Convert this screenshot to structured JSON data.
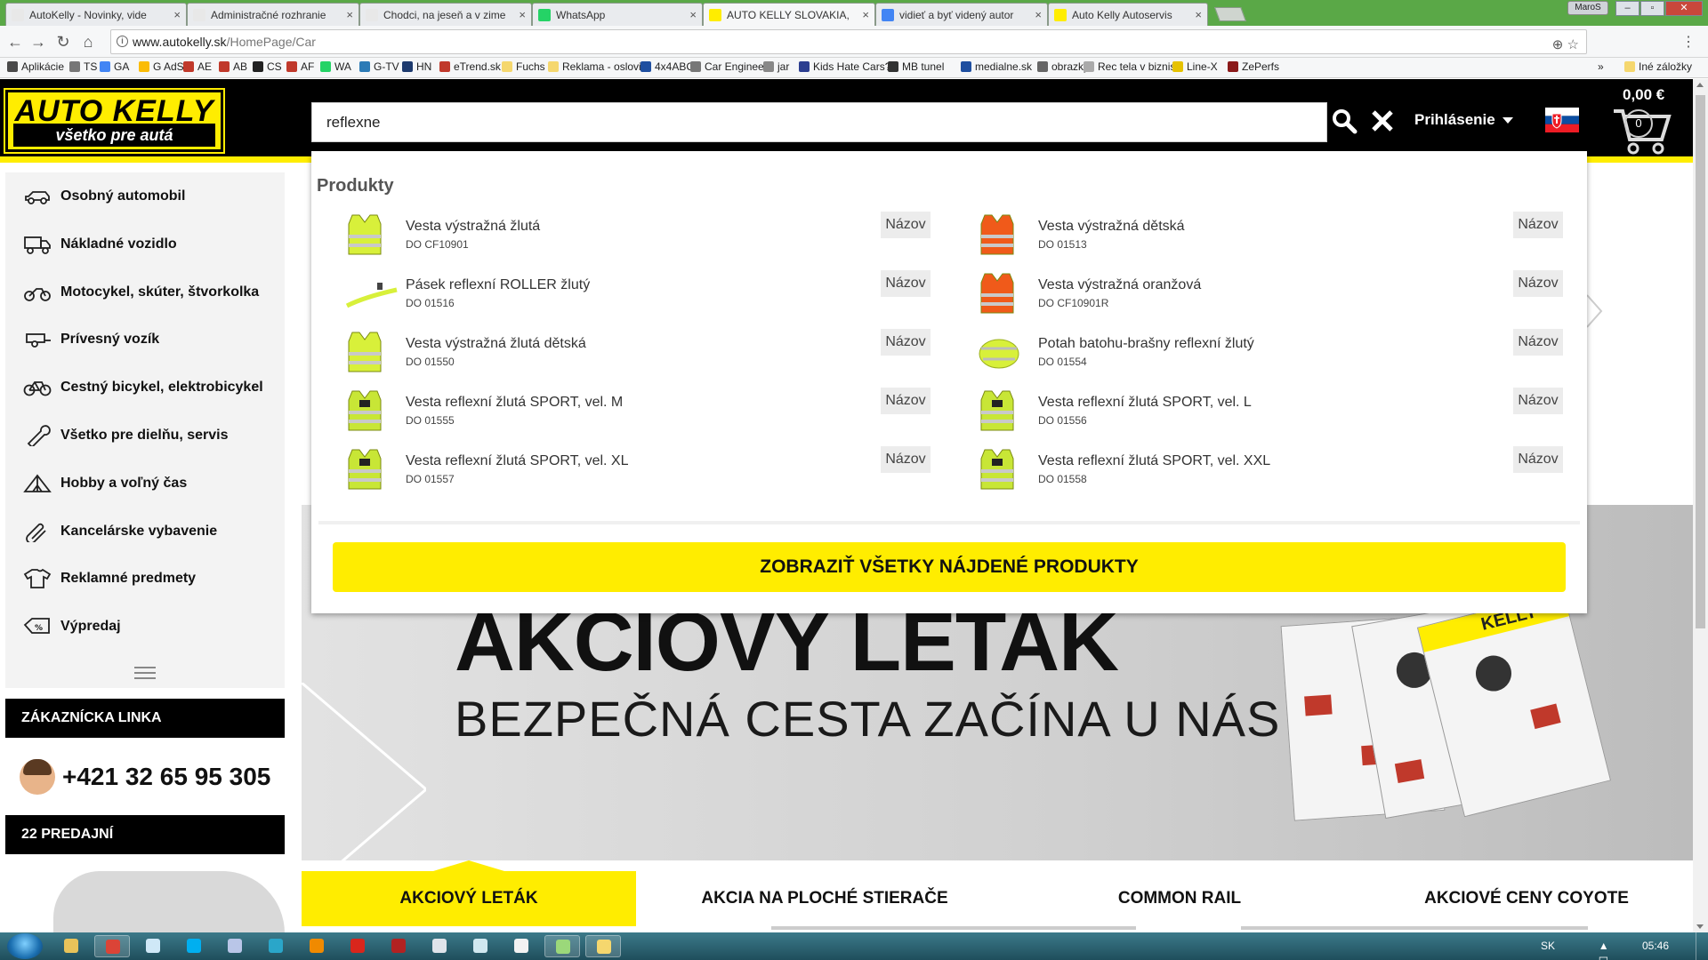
{
  "browser": {
    "tabs": [
      {
        "title": "AutoKelly - Novinky, vide",
        "fav_color": "#e8e8e8",
        "active": false
      },
      {
        "title": "Administračné rozhranie",
        "fav_color": "#e8e8e8",
        "active": false
      },
      {
        "title": "Chodci, na jeseň a v zime",
        "fav_color": "#e8e8e8",
        "active": false
      },
      {
        "title": "WhatsApp",
        "fav_color": "#25d366",
        "active": false
      },
      {
        "title": "AUTO KELLY SLOVAKIA,",
        "fav_color": "#ffed00",
        "active": true
      },
      {
        "title": "vidieť a byť videný autor",
        "fav_color": "#4285f4",
        "active": false
      },
      {
        "title": "Auto Kelly Autoservis",
        "fav_color": "#ffed00",
        "active": false
      }
    ],
    "profile_label": "MaroS",
    "url_host": "www.autokelly.sk",
    "url_path": "/HomePage/Car",
    "bookmarks": [
      {
        "label": "Aplikácie",
        "color": "#4a4a4a"
      },
      {
        "label": "TS",
        "color": "#777"
      },
      {
        "label": "GA",
        "color": "#4285f4"
      },
      {
        "label": "G AdS",
        "color": "#fbbc05"
      },
      {
        "label": "AE",
        "color": "#c0392b"
      },
      {
        "label": "AB",
        "color": "#c0392b"
      },
      {
        "label": "CS",
        "color": "#222"
      },
      {
        "label": "AF",
        "color": "#c0392b"
      },
      {
        "label": "WA",
        "color": "#25d366"
      },
      {
        "label": "G-TV",
        "color": "#2c7bb6"
      },
      {
        "label": "HN",
        "color": "#1d3a6e"
      },
      {
        "label": "eTrend.sk",
        "color": "#c0392b"
      },
      {
        "label": "Fuchs",
        "color": "#f5d76e"
      },
      {
        "label": "Reklama - oslovit",
        "color": "#f5d76e"
      },
      {
        "label": "4x4ABC",
        "color": "#1f4fa0"
      },
      {
        "label": "Car Engineer",
        "color": "#777"
      },
      {
        "label": "jar",
        "color": "#888"
      },
      {
        "label": "Kids Hate Cars?",
        "color": "#2c3e90"
      },
      {
        "label": "MB tunel",
        "color": "#333"
      },
      {
        "label": "medialne.sk",
        "color": "#1f4fa0"
      },
      {
        "label": "obrazky",
        "color": "#666"
      },
      {
        "label": "Rec tela v biznise",
        "color": "#aaa"
      },
      {
        "label": "Line-X",
        "color": "#e6c200"
      },
      {
        "label": "ZePerfs",
        "color": "#8b1a1a"
      }
    ],
    "bookmarks_more": "»",
    "other_bookmarks": "Iné záložky"
  },
  "header": {
    "logo_line1": "AUTO KELLY",
    "logo_line2": "všetko pre autá",
    "search_value": "reflexne",
    "login_label": "Prihlásenie",
    "cart_total": "0,00 €",
    "cart_count": "0"
  },
  "sidebar": {
    "items": [
      {
        "label": "Osobný automobil",
        "icon": "car-icon"
      },
      {
        "label": "Nákladné vozidlo",
        "icon": "truck-icon"
      },
      {
        "label": "Motocykel, skúter, štvorkolka",
        "icon": "motorcycle-icon"
      },
      {
        "label": "Prívesný vozík",
        "icon": "trailer-icon"
      },
      {
        "label": "Cestný bicykel, elektrobicykel",
        "icon": "bicycle-icon"
      },
      {
        "label": "Všetko pre dielňu, servis",
        "icon": "wrench-icon"
      },
      {
        "label": "Hobby a voľný čas",
        "icon": "tent-icon"
      },
      {
        "label": "Kancelárske vybavenie",
        "icon": "paperclip-icon"
      },
      {
        "label": "Reklamné predmety",
        "icon": "tshirt-icon"
      },
      {
        "label": "Výpredaj",
        "icon": "discount-tag-icon"
      }
    ],
    "hotline_title": "ZÁKAZNÍCKA LINKA",
    "phone": "+421 32 65 95 305",
    "shops_title": "22 PREDAJNÍ"
  },
  "dropdown": {
    "section_title": "Produkty",
    "products": [
      {
        "name": "Vesta výstražná žlutá",
        "code": "DO CF10901",
        "button": "Názov",
        "thumb": "vest-yellow",
        "color": "#d8f03a"
      },
      {
        "name": "Vesta výstražná dětská",
        "code": "DO 01513",
        "button": "Názov",
        "thumb": "vest-orange",
        "color": "#f05a1a"
      },
      {
        "name": "Pásek reflexní ROLLER žlutý",
        "code": "DO 01516",
        "button": "Názov",
        "thumb": "band-yellow",
        "color": "#d8f03a"
      },
      {
        "name": "Vesta výstražná oranžová",
        "code": "DO CF10901R",
        "button": "Názov",
        "thumb": "vest-orange",
        "color": "#f05a1a"
      },
      {
        "name": "Vesta výstražná žlutá dětská",
        "code": "DO 01550",
        "button": "Názov",
        "thumb": "vest-yellow",
        "color": "#d8f03a"
      },
      {
        "name": "Potah batohu-brašny reflexní žlutý",
        "code": "DO 01554",
        "button": "Názov",
        "thumb": "bag-cover",
        "color": "#d8f03a"
      },
      {
        "name": "Vesta reflexní žlutá SPORT, vel. M",
        "code": "DO 01555",
        "button": "Názov",
        "thumb": "sport-vest",
        "color": "#c8e636"
      },
      {
        "name": "Vesta reflexní žlutá SPORT, vel. L",
        "code": "DO 01556",
        "button": "Názov",
        "thumb": "sport-vest",
        "color": "#c8e636"
      },
      {
        "name": "Vesta reflexní žlutá SPORT, vel. XL",
        "code": "DO 01557",
        "button": "Názov",
        "thumb": "sport-vest",
        "color": "#c8e636"
      },
      {
        "name": "Vesta reflexní žlutá SPORT, vel. XXL",
        "code": "DO 01558",
        "button": "Názov",
        "thumb": "sport-vest",
        "color": "#c8e636"
      }
    ],
    "show_all_label": "ZOBRAZIŤ VŠETKY NÁJDENÉ PRODUKTY"
  },
  "banner": {
    "headline": "AKCIOVY LETAK",
    "subline": "BEZPEČNÁ CESTA ZAČÍNA U NÁS",
    "flyer_brand": "KELLY"
  },
  "promo_tabs": [
    {
      "label": "AKCIOVÝ LETÁK",
      "active": true
    },
    {
      "label": "AKCIA NA PLOCHÉ STIERAČE",
      "active": false
    },
    {
      "label": "COMMON RAIL",
      "active": false
    },
    {
      "label": "AKCIOVÉ CENY COYOTE",
      "active": false
    }
  ],
  "taskbar": {
    "language": "SK",
    "time": "05:46"
  },
  "colors": {
    "brand_yellow": "#ffed00",
    "header_black": "#000000",
    "tabstrip_green": "#5aa847"
  }
}
